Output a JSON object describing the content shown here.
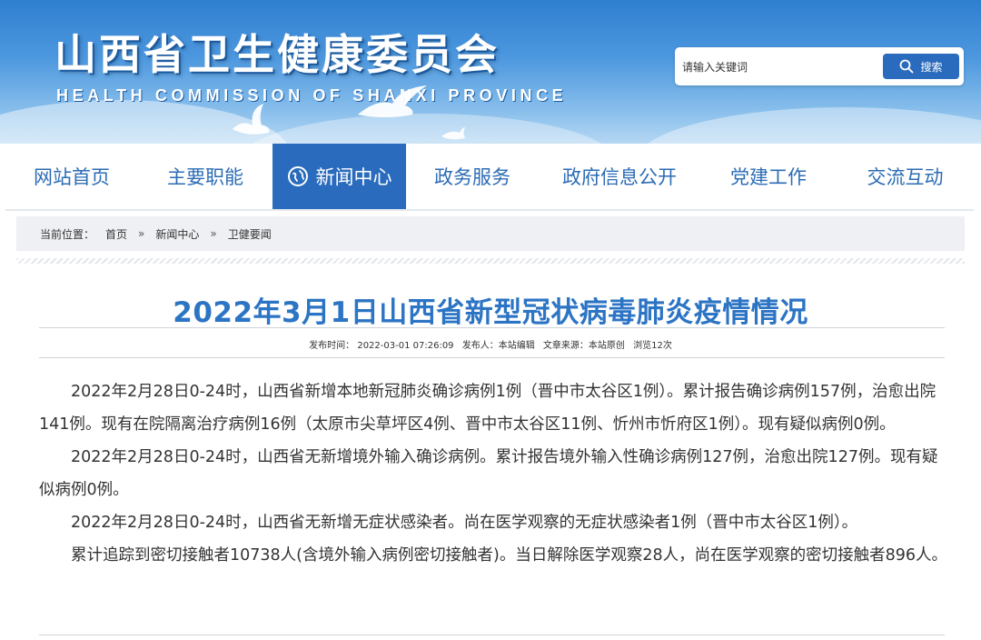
{
  "header": {
    "title": "山西省卫生健康委员会",
    "subtitle": "HEALTH COMMISSION OF SHANXI PROVINCE",
    "search_placeholder": "请输入关键词",
    "search_button": "搜索",
    "icons": [
      "search-icon",
      "dove-icon"
    ]
  },
  "nav": {
    "items": [
      {
        "label": "网站首页"
      },
      {
        "label": "主要职能"
      },
      {
        "label": "新闻中心",
        "active": true,
        "icon": "globe-icon"
      },
      {
        "label": "政务服务"
      },
      {
        "label": "政府信息公开"
      },
      {
        "label": "党建工作"
      },
      {
        "label": "交流互动"
      }
    ]
  },
  "breadcrumb": {
    "prefix": "当前位置：",
    "items": [
      "首页",
      "新闻中心",
      "卫健要闻"
    ],
    "separator": "»"
  },
  "article": {
    "title": "2022年3月1日山西省新型冠状病毒肺炎疫情情况",
    "meta": {
      "publish_time": "发布时间： 2022-03-01 07:26:09",
      "publisher": "发布人：本站编辑",
      "source": "文章来源：本站原创",
      "views": "浏览12次"
    },
    "paragraphs": [
      "2022年2月28日0-24时，山西省新增本地新冠肺炎确诊病例1例（晋中市太谷区1例）。累计报告确诊病例157例，治愈出院141例。现有在院隔离治疗病例16例（太原市尖草坪区4例、晋中市太谷区11例、忻州市忻府区1例）。现有疑似病例0例。",
      "2022年2月28日0-24时，山西省无新增境外输入确诊病例。累计报告境外输入性确诊病例127例，治愈出院127例。现有疑似病例0例。",
      "2022年2月28日0-24时，山西省无新增无症状感染者。尚在医学观察的无症状感染者1例（晋中市太谷区1例）。",
      "累计追踪到密切接触者10738人(含境外输入病例密切接触者)。当日解除医学观察28人，尚在医学观察的密切接触者896人。"
    ]
  },
  "colors": {
    "primary_blue": "#2a6bbd",
    "title_blue": "#2c74c4",
    "nav_text": "#2c6cb5"
  }
}
